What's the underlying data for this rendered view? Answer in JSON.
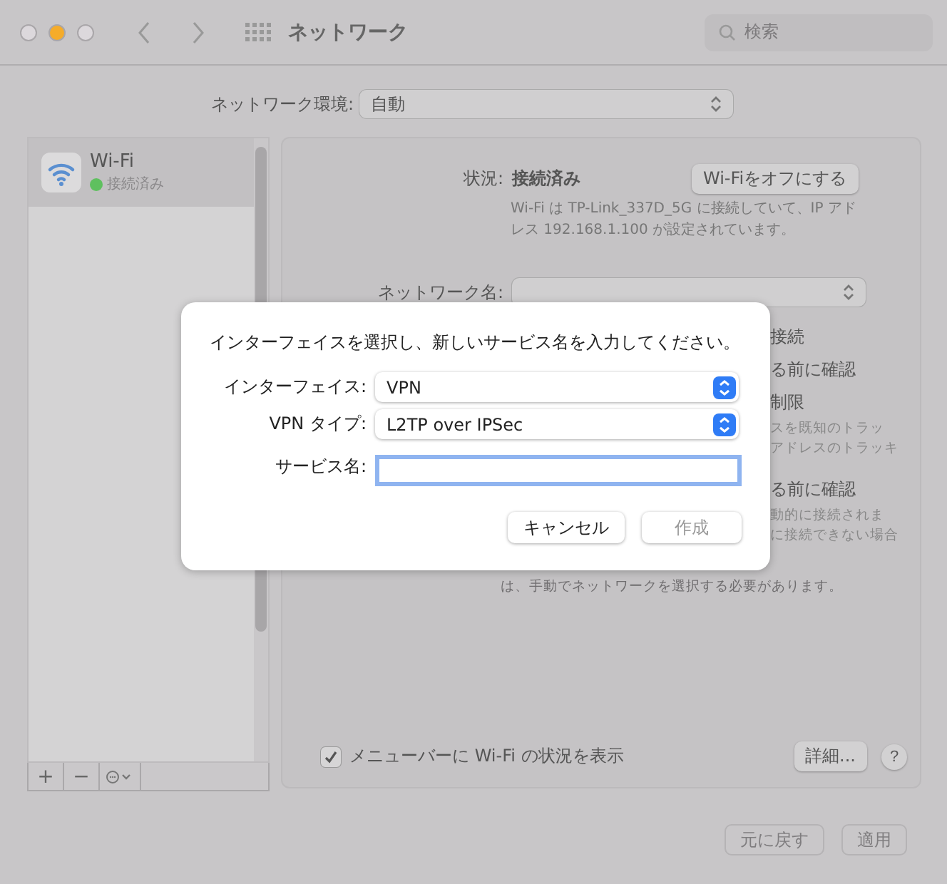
{
  "window": {
    "title": "ネットワーク",
    "search": {
      "placeholder": "検索"
    }
  },
  "location": {
    "label": "ネットワーク環境:",
    "value": "自動"
  },
  "sidebar": {
    "items": [
      {
        "name": "Wi-Fi",
        "status": "接続済み",
        "color": "#5fc05f",
        "selected": true
      }
    ],
    "toolbar": [
      "+",
      "−"
    ]
  },
  "detail": {
    "status_label": "状況:",
    "status_value": "接続済み",
    "toggle_button": "Wi-Fiをオフにする",
    "description": "Wi-Fi は TP-Link_337D_5G に接続していて、IP アドレス 192.168.1.100 が設定されています。",
    "network_label": "ネットワーク名:",
    "partial_texts": [
      {
        "text": "接続",
        "kind": "option"
      },
      {
        "text": "る前に確認",
        "kind": "option"
      },
      {
        "text": "制限",
        "kind": "option"
      },
      {
        "text": "スを既知のトラッ",
        "kind": "note"
      },
      {
        "text": "アドレスのトラッキ",
        "kind": "note"
      },
      {
        "text": "る前に確認",
        "kind": "gap"
      },
      {
        "text": "動的に接続されま",
        "kind": "note"
      },
      {
        "text": "に接続できない場合",
        "kind": "note"
      }
    ],
    "footnote": "は、手動でネットワークを選択する必要があります。",
    "menubar_checkbox": {
      "label": "メニューバーに Wi-Fi の状況を表示",
      "checked": true
    },
    "advanced_button": "詳細...",
    "help_button": "?"
  },
  "footer_buttons": [
    {
      "label": "元に戻す",
      "disabled": true
    },
    {
      "label": "適用",
      "disabled": true
    }
  ],
  "dialog": {
    "message": "インターフェイスを選択し、新しいサービス名を入力してください。",
    "fields": [
      {
        "label": "インターフェイス:",
        "kind": "popup",
        "value": "VPN"
      },
      {
        "label": "VPN タイプ:",
        "kind": "popup",
        "value": "L2TP over IPSec"
      },
      {
        "label": "サービス名:",
        "kind": "text"
      }
    ],
    "buttons": [
      {
        "label": "キャンセル",
        "disabled": false
      },
      {
        "label": "作成",
        "disabled": true
      }
    ]
  }
}
